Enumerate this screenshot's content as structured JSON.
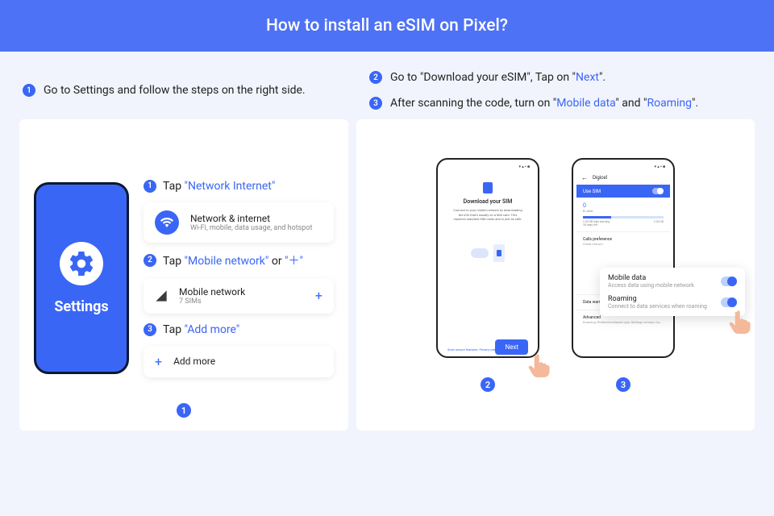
{
  "header": {
    "title": "How to install an eSIM on Pixel?"
  },
  "instructions": {
    "left": {
      "num": "1",
      "text": "Go to Settings and follow the steps on the right side."
    },
    "right": [
      {
        "num": "2",
        "pre": "Go to \"Download your eSIM\", Tap on \"",
        "hl": "Next",
        "post": "\"."
      },
      {
        "num": "3",
        "pre": "After scanning the code, turn on \"",
        "hl1": "Mobile data",
        "mid": "\" and \"",
        "hl2": "Roaming",
        "post": "\"."
      }
    ]
  },
  "phone": {
    "settings_label": "Settings"
  },
  "steps": [
    {
      "num": "1",
      "tap": "Tap ",
      "hl": "\"Network Internet\"",
      "card_title": "Network & internet",
      "card_sub": "Wi-Fi, mobile, data usage, and hotspot"
    },
    {
      "num": "2",
      "tap": "Tap ",
      "hl": "\"Mobile network\"",
      "or": " or ",
      "hl2": "\"＋\"",
      "card_title": "Mobile network",
      "card_sub": "7 SIMs"
    },
    {
      "num": "3",
      "tap": "Tap ",
      "hl": "\"Add more\"",
      "card_title": "Add more"
    }
  ],
  "badges": {
    "left_panel": "1",
    "right_phone_a": "2",
    "right_phone_b": "3"
  },
  "sim_screen": {
    "title": "Download your SIM",
    "desc": "Connect to your mobile network by downloading the info that's usually on a SIM card. This replaces standard SIM cards and is just as safe.",
    "links": "Scan secure features. Privacy path",
    "next": "Next"
  },
  "digicel": {
    "title": "Digicel",
    "use_sim": "Use SIM",
    "zero": "0",
    "used": "B used",
    "warn": "2.00 GB data warning",
    "days": "30 days left",
    "limit": "2.00 GB",
    "calls_pref": "Calls preference",
    "calls_sub": "China Unicom",
    "data_warn": "Data warning & limit",
    "advanced": "Advanced",
    "advanced_sub": "Roaming, Preferred network type, Settings version, Ca..."
  },
  "float": {
    "mobile_data": "Mobile data",
    "mobile_sub": "Access data using mobile network",
    "roaming": "Roaming",
    "roaming_sub": "Connect to data services when roaming"
  }
}
